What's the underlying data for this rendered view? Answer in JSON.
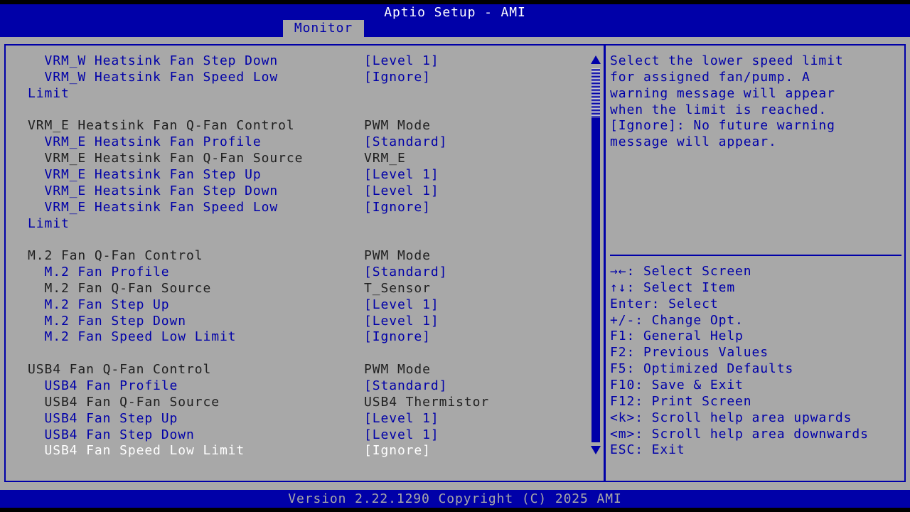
{
  "header": {
    "title": "Aptio Setup - AMI",
    "tab": "Monitor"
  },
  "settings": [
    {
      "label": "  VRM_W Heatsink Fan Step Down",
      "value": "[Level 1]",
      "style": "blue"
    },
    {
      "label": "  VRM_W Heatsink Fan Speed Low",
      "value": "[Ignore]",
      "style": "blue"
    },
    {
      "label": "Limit",
      "value": "",
      "style": "blue"
    },
    {
      "label": "",
      "value": "",
      "style": "gray"
    },
    {
      "label": "VRM_E Heatsink Fan Q-Fan Control",
      "value": "PWM Mode",
      "style": "gray"
    },
    {
      "label": "  VRM_E Heatsink Fan Profile",
      "value": "[Standard]",
      "style": "blue"
    },
    {
      "label": "  VRM_E Heatsink Fan Q-Fan Source",
      "value": "VRM_E",
      "style": "gray"
    },
    {
      "label": "  VRM_E Heatsink Fan Step Up",
      "value": "[Level 1]",
      "style": "blue"
    },
    {
      "label": "  VRM_E Heatsink Fan Step Down",
      "value": "[Level 1]",
      "style": "blue"
    },
    {
      "label": "  VRM_E Heatsink Fan Speed Low",
      "value": "[Ignore]",
      "style": "blue"
    },
    {
      "label": "Limit",
      "value": "",
      "style": "blue"
    },
    {
      "label": "",
      "value": "",
      "style": "gray"
    },
    {
      "label": "M.2 Fan Q-Fan Control",
      "value": "PWM Mode",
      "style": "gray"
    },
    {
      "label": "  M.2 Fan Profile",
      "value": "[Standard]",
      "style": "blue"
    },
    {
      "label": "  M.2 Fan Q-Fan Source",
      "value": "T_Sensor",
      "style": "gray"
    },
    {
      "label": "  M.2 Fan Step Up",
      "value": "[Level 1]",
      "style": "blue"
    },
    {
      "label": "  M.2 Fan Step Down",
      "value": "[Level 1]",
      "style": "blue"
    },
    {
      "label": "  M.2 Fan Speed Low Limit",
      "value": "[Ignore]",
      "style": "blue"
    },
    {
      "label": "",
      "value": "",
      "style": "gray"
    },
    {
      "label": "USB4 Fan Q-Fan Control",
      "value": "PWM Mode",
      "style": "gray"
    },
    {
      "label": "  USB4 Fan Profile",
      "value": "[Standard]",
      "style": "blue"
    },
    {
      "label": "  USB4 Fan Q-Fan Source",
      "value": "USB4 Thermistor",
      "style": "gray"
    },
    {
      "label": "  USB4 Fan Step Up",
      "value": "[Level 1]",
      "style": "blue"
    },
    {
      "label": "  USB4 Fan Step Down",
      "value": "[Level 1]",
      "style": "blue"
    },
    {
      "label": "  USB4 Fan Speed Low Limit",
      "value": "[Ignore]",
      "style": "white"
    }
  ],
  "help": [
    "Select the lower speed limit",
    "for assigned fan/pump. A",
    "warning message will appear",
    "when the limit is reached.",
    "[Ignore]: No future warning",
    "message will appear."
  ],
  "keys": [
    "→←: Select Screen",
    "↑↓: Select Item",
    "Enter: Select",
    "+/-: Change Opt.",
    "F1: General Help",
    "F2: Previous Values",
    "F5: Optimized Defaults",
    "F10: Save & Exit",
    "F12: Print Screen",
    "<k>: Scroll help area upwards",
    "<m>: Scroll help area downwards",
    "ESC: Exit"
  ],
  "footer": {
    "text": "Version 2.22.1290 Copyright (C) 2025 AMI"
  },
  "colors": {
    "blue": "#0000a8",
    "gray_bg": "#a8a8a8",
    "text_dark": "#202020",
    "highlight": "#ffffff"
  },
  "selected_index": 24
}
